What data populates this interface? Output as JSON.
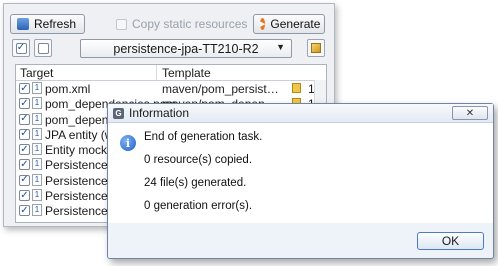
{
  "toolbar": {
    "refresh_label": "Refresh",
    "copy_static_label": "Copy static resources",
    "generate_label": "Generate"
  },
  "selector": {
    "value": "persistence-jpa-TT210-R2"
  },
  "table": {
    "headers": [
      "Target",
      "Template"
    ],
    "rows": [
      {
        "target": "pom.xml",
        "template": "maven/pom_persistence_x...",
        "count": "1",
        "checked": true
      },
      {
        "target": "pom_dependencies.pom",
        "template": "maven/pom_dependencie...",
        "count": "1",
        "checked": true
      },
      {
        "target": "pom_dependencies...",
        "template": "",
        "count": "",
        "checked": true
      },
      {
        "target": "JPA entity (with",
        "template": "",
        "count": "",
        "checked": true
      },
      {
        "target": "Entity mock too",
        "template": "",
        "count": "",
        "checked": true
      },
      {
        "target": "Persistence serv",
        "template": "",
        "count": "",
        "checked": true
      },
      {
        "target": "Persistence serv",
        "template": "",
        "count": "",
        "checked": true
      },
      {
        "target": "Persistence serv",
        "template": "",
        "count": "",
        "checked": true
      },
      {
        "target": "Persistence serv",
        "template": "",
        "count": "",
        "checked": true
      }
    ]
  },
  "dialog": {
    "title": "Information",
    "messages": [
      "End of generation task.",
      "0 resource(s) copied.",
      "24 file(s) generated.",
      "0 generation error(s)."
    ],
    "ok_label": "OK",
    "close_symbol": "✕"
  },
  "colors": {
    "accent": "#1f5fc9",
    "generate_icon": "#e8761c"
  }
}
